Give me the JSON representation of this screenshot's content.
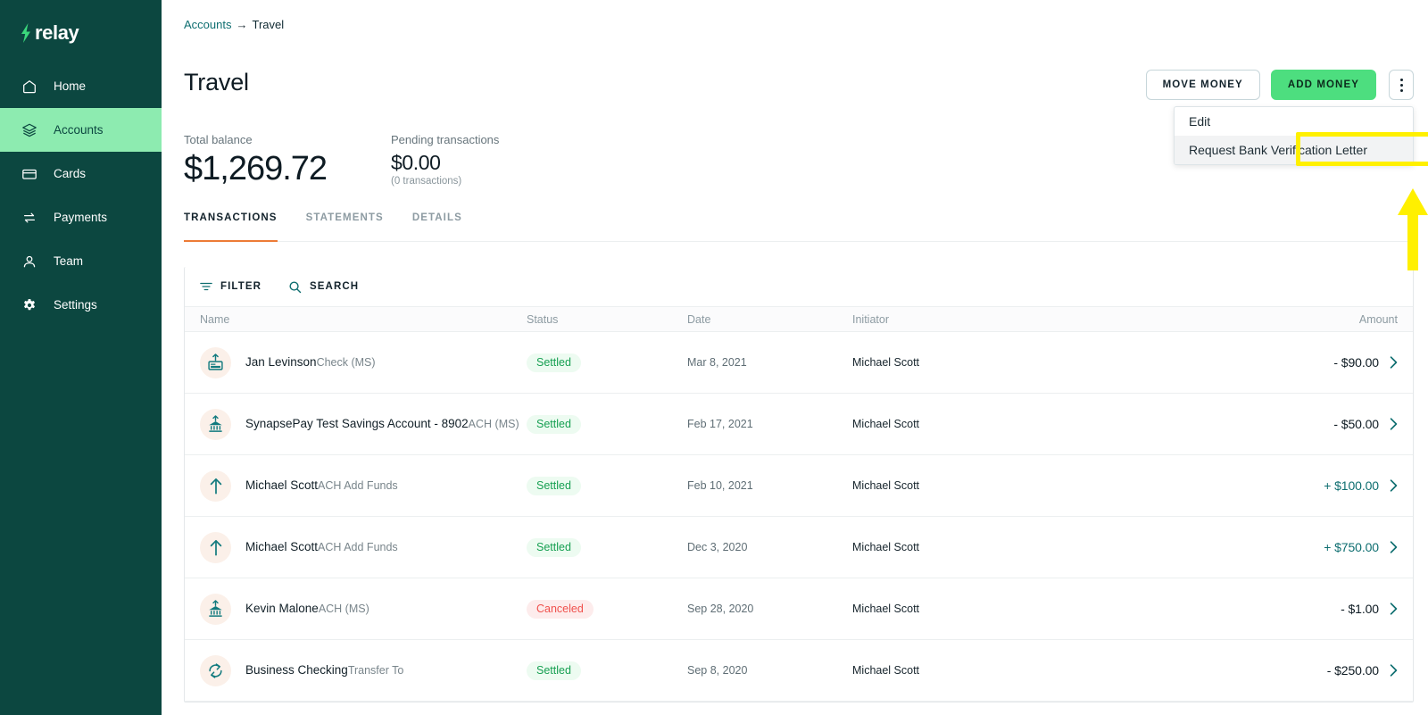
{
  "brand": {
    "name": "relay",
    "logo_icon": "lightning-bolt-icon",
    "bg_color": "#0C4740",
    "accent_green": "#4DDE7F"
  },
  "sidebar": {
    "items": [
      {
        "label": "Home",
        "icon": "home-icon",
        "active": false
      },
      {
        "label": "Accounts",
        "icon": "layers-icon",
        "active": true
      },
      {
        "label": "Cards",
        "icon": "card-icon",
        "active": false
      },
      {
        "label": "Payments",
        "icon": "transfer-icon",
        "active": false
      },
      {
        "label": "Team",
        "icon": "person-icon",
        "active": false
      },
      {
        "label": "Settings",
        "icon": "gear-icon",
        "active": false
      }
    ]
  },
  "breadcrumb": {
    "root": "Accounts",
    "separator": "→",
    "current": "Travel"
  },
  "page": {
    "title": "Travel"
  },
  "balances": {
    "total_label": "Total balance",
    "total_value": "$1,269.72",
    "pending_label": "Pending transactions",
    "pending_value": "$0.00",
    "pending_sub": "(0 transactions)"
  },
  "actions": {
    "move_money": "MOVE MONEY",
    "add_money": "ADD MONEY",
    "kebab_icon": "more-vertical-icon"
  },
  "dropdown": {
    "items": [
      {
        "label": "Edit",
        "hovered": false
      },
      {
        "label": "Request Bank Verification Letter",
        "hovered": true
      }
    ]
  },
  "annotation": {
    "highlight_color": "#FFF000",
    "arrow_icon": "up-arrow-annotation",
    "target": "Request Bank Verification Letter"
  },
  "tabs": [
    {
      "label": "TRANSACTIONS",
      "active": true
    },
    {
      "label": "STATEMENTS",
      "active": false
    },
    {
      "label": "DETAILS",
      "active": false
    }
  ],
  "toolbar": {
    "filter_label": "FILTER",
    "filter_icon": "filter-icon",
    "search_label": "SEARCH",
    "search_icon": "search-icon"
  },
  "table": {
    "columns": [
      "Name",
      "Status",
      "Date",
      "Initiator",
      "Amount"
    ],
    "rows": [
      {
        "icon": "check-upload-icon",
        "name": "Jan Levinson",
        "sub": "Check (MS)",
        "status": "Settled",
        "status_kind": "settled",
        "date": "Mar 8, 2021",
        "initiator": "Michael Scott",
        "amount": "- $90.00",
        "amount_kind": "neg",
        "chevron": "chevron-right-icon"
      },
      {
        "icon": "bank-upload-icon",
        "name": "SynapsePay Test Savings Account - 8902",
        "sub": "ACH (MS)",
        "status": "Settled",
        "status_kind": "settled",
        "date": "Feb 17, 2021",
        "initiator": "Michael Scott",
        "amount": "- $50.00",
        "amount_kind": "neg",
        "chevron": "chevron-right-icon"
      },
      {
        "icon": "arrow-up-icon",
        "name": "Michael Scott",
        "sub": "ACH Add Funds",
        "status": "Settled",
        "status_kind": "settled",
        "date": "Feb 10, 2021",
        "initiator": "Michael Scott",
        "amount": "+ $100.00",
        "amount_kind": "pos",
        "chevron": "chevron-right-icon"
      },
      {
        "icon": "arrow-up-icon",
        "name": "Michael Scott",
        "sub": "ACH Add Funds",
        "status": "Settled",
        "status_kind": "settled",
        "date": "Dec 3, 2020",
        "initiator": "Michael Scott",
        "amount": "+ $750.00",
        "amount_kind": "pos",
        "chevron": "chevron-right-icon"
      },
      {
        "icon": "bank-upload-icon",
        "name": "Kevin Malone",
        "sub": "ACH (MS)",
        "status": "Canceled",
        "status_kind": "canceled",
        "date": "Sep 28, 2020",
        "initiator": "Michael Scott",
        "amount": "- $1.00",
        "amount_kind": "neg",
        "chevron": "chevron-right-icon"
      },
      {
        "icon": "transfer-circle-icon",
        "name": "Business Checking",
        "sub": "Transfer To",
        "status": "Settled",
        "status_kind": "settled",
        "date": "Sep 8, 2020",
        "initiator": "Michael Scott",
        "amount": "- $250.00",
        "amount_kind": "neg",
        "chevron": "chevron-right-icon"
      }
    ]
  }
}
